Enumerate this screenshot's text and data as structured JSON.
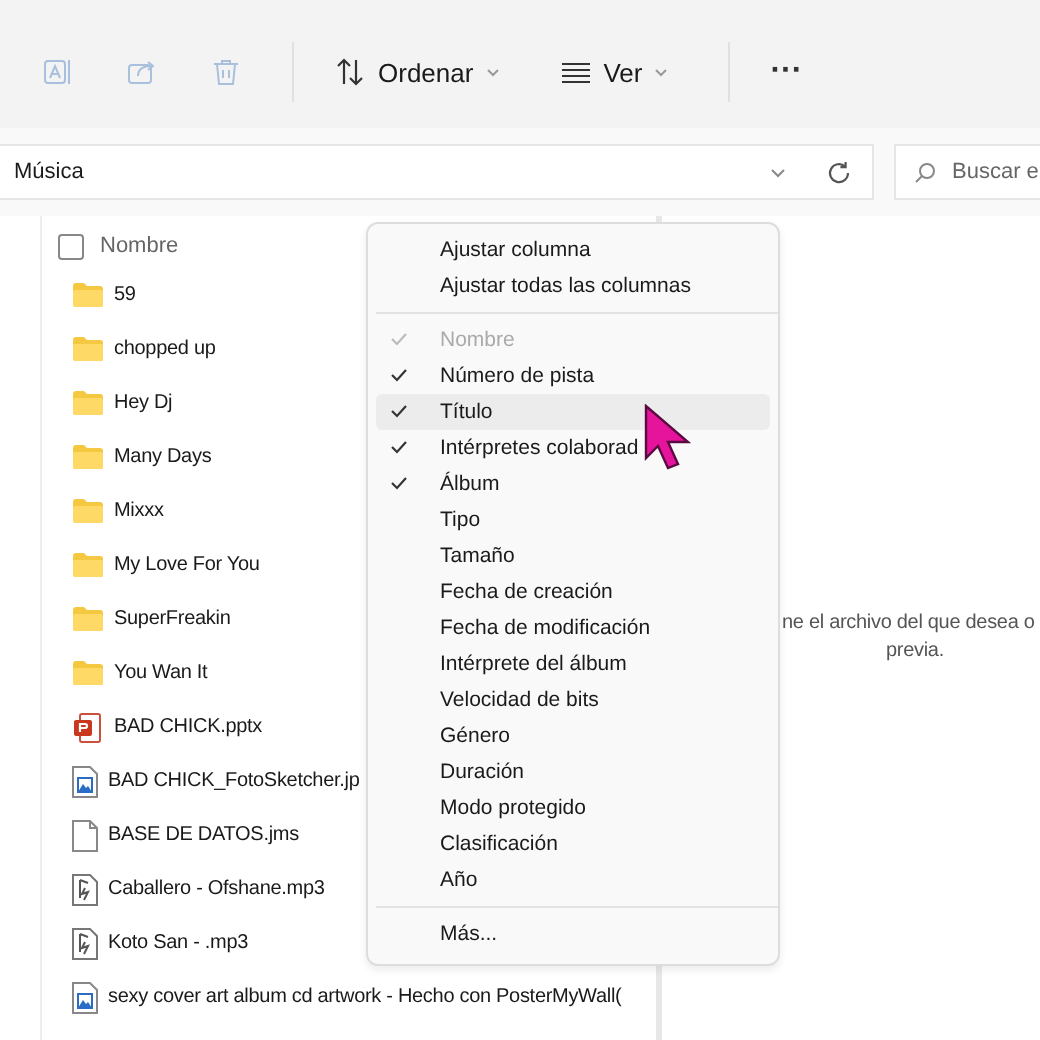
{
  "toolbar": {
    "actions": [
      {
        "kind": "rename",
        "disabled": true
      },
      {
        "kind": "share",
        "disabled": true
      },
      {
        "kind": "delete",
        "disabled": true
      }
    ],
    "sort": {
      "label": "Ordenar"
    },
    "view": {
      "label": "Ver"
    },
    "more": {
      "label": "···"
    }
  },
  "address": {
    "path": "Música"
  },
  "search": {
    "placeholder": "Buscar e"
  },
  "list": {
    "header": {
      "label": "Nombre",
      "checked": false
    },
    "items": [
      {
        "name": "59",
        "kind": "folder"
      },
      {
        "name": "chopped up",
        "kind": "folder"
      },
      {
        "name": "Hey Dj",
        "kind": "folder"
      },
      {
        "name": "Many Days",
        "kind": "folder"
      },
      {
        "name": "Mixxx",
        "kind": "folder"
      },
      {
        "name": "My Love For You",
        "kind": "folder"
      },
      {
        "name": "SuperFreakin",
        "kind": "folder"
      },
      {
        "name": "You Wan It",
        "kind": "folder"
      },
      {
        "name": "BAD CHICK.pptx",
        "kind": "slides"
      },
      {
        "name": "BAD CHICK_FotoSketcher.jp",
        "kind": "image"
      },
      {
        "name": "BASE DE DATOS.jms",
        "kind": "file"
      },
      {
        "name": "Caballero - Ofshane.mp3",
        "kind": "audio"
      },
      {
        "name": "Koto San - .mp3",
        "kind": "audio"
      },
      {
        "name": "sexy cover art album cd artwork - Hecho con PosterMyWall(",
        "kind": "image"
      }
    ]
  },
  "preview": {
    "lines": [
      "ne el archivo del que desea o",
      "previa."
    ]
  },
  "context_menu": {
    "items": [
      {
        "kind": "action",
        "label": "Ajustar columna"
      },
      {
        "kind": "action",
        "label": "Ajustar todas las columnas"
      },
      {
        "kind": "separator"
      },
      {
        "kind": "column",
        "label": "Nombre",
        "checked": true,
        "disabled": true,
        "highlighted": false
      },
      {
        "kind": "column",
        "label": "Número de pista",
        "checked": true,
        "disabled": false,
        "highlighted": false
      },
      {
        "kind": "column",
        "label": "Título",
        "checked": true,
        "disabled": false,
        "highlighted": true
      },
      {
        "kind": "column",
        "label": "Intérpretes colaborad",
        "checked": true,
        "disabled": false,
        "highlighted": false
      },
      {
        "kind": "column",
        "label": "Álbum",
        "checked": true,
        "disabled": false,
        "highlighted": false
      },
      {
        "kind": "column",
        "label": "Tipo",
        "checked": false,
        "disabled": false,
        "highlighted": false
      },
      {
        "kind": "column",
        "label": "Tamaño",
        "checked": false,
        "disabled": false,
        "highlighted": false
      },
      {
        "kind": "column",
        "label": "Fecha de creación",
        "checked": false,
        "disabled": false,
        "highlighted": false
      },
      {
        "kind": "column",
        "label": "Fecha de modificación",
        "checked": false,
        "disabled": false,
        "highlighted": false
      },
      {
        "kind": "column",
        "label": "Intérprete del álbum",
        "checked": false,
        "disabled": false,
        "highlighted": false
      },
      {
        "kind": "column",
        "label": "Velocidad de bits",
        "checked": false,
        "disabled": false,
        "highlighted": false
      },
      {
        "kind": "column",
        "label": "Género",
        "checked": false,
        "disabled": false,
        "highlighted": false
      },
      {
        "kind": "column",
        "label": "Duración",
        "checked": false,
        "disabled": false,
        "highlighted": false
      },
      {
        "kind": "column",
        "label": "Modo protegido",
        "checked": false,
        "disabled": false,
        "highlighted": false
      },
      {
        "kind": "column",
        "label": "Clasificación",
        "checked": false,
        "disabled": false,
        "highlighted": false
      },
      {
        "kind": "column",
        "label": "Año",
        "checked": false,
        "disabled": false,
        "highlighted": false
      },
      {
        "kind": "separator"
      },
      {
        "kind": "action",
        "label": "Más..."
      }
    ]
  }
}
